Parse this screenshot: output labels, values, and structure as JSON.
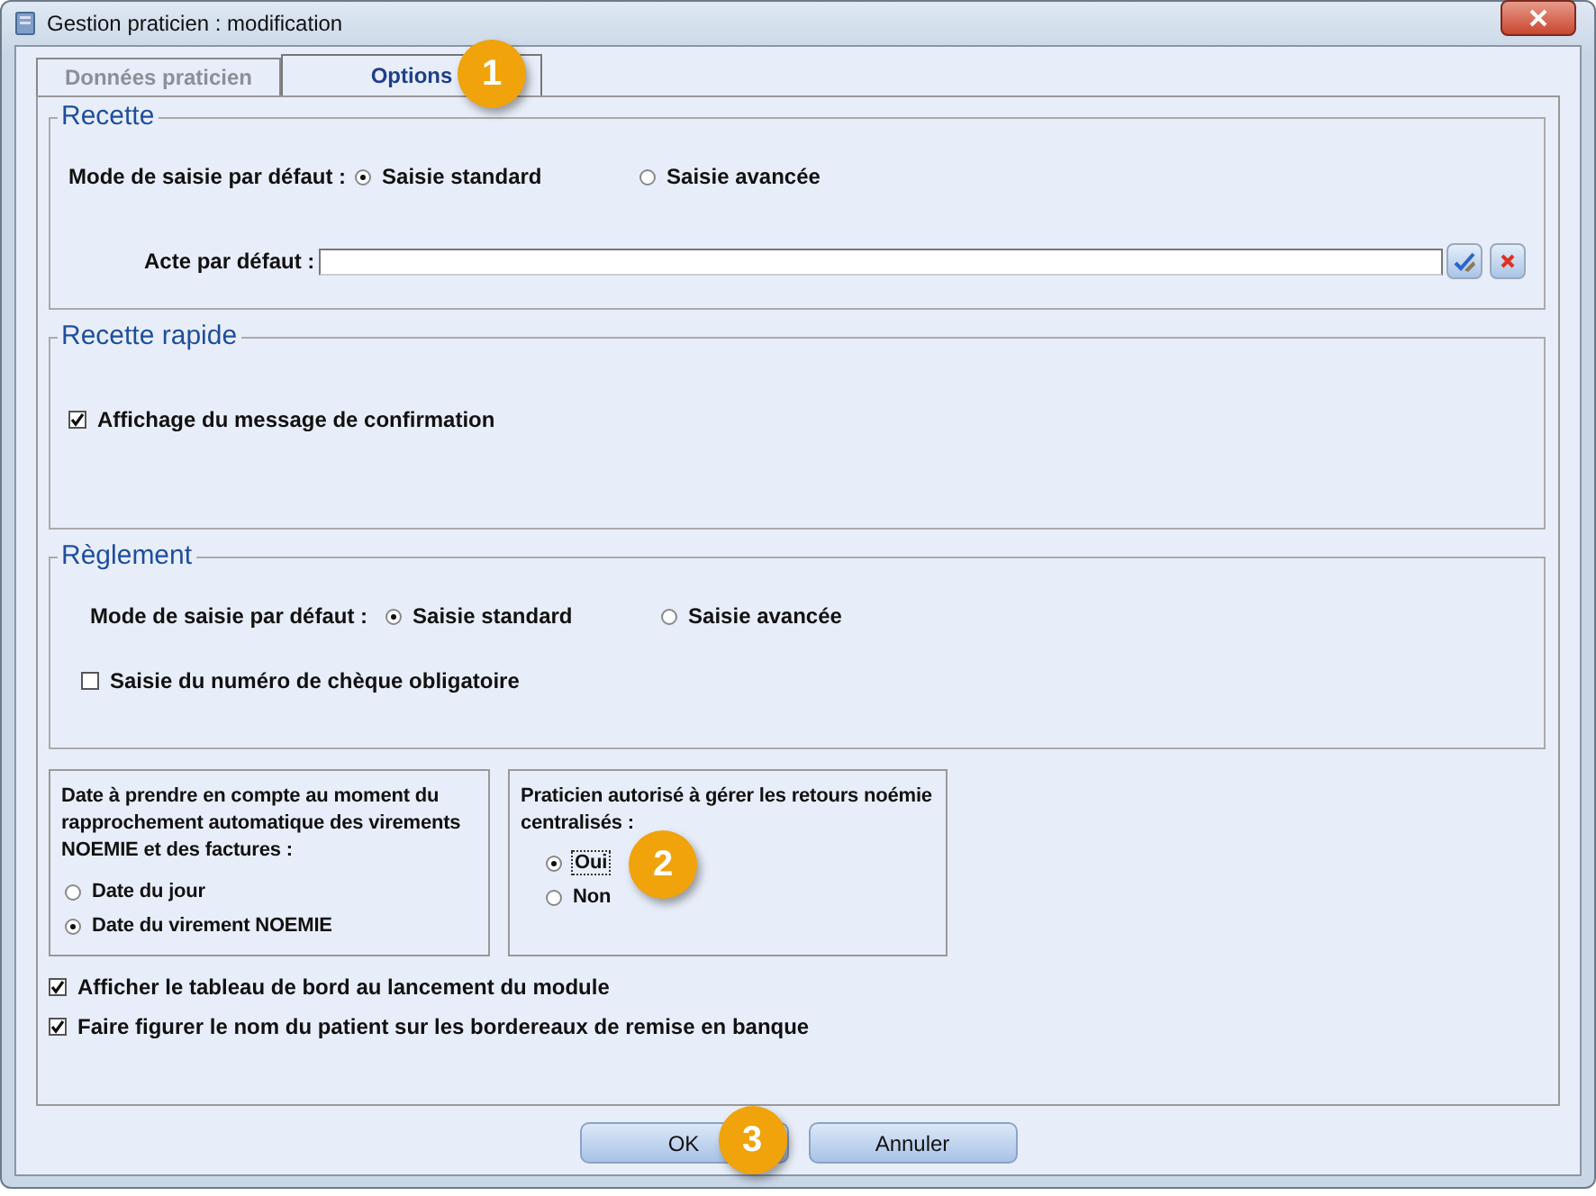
{
  "window": {
    "title": "Gestion praticien : modification"
  },
  "tabs": [
    {
      "label": "Données praticien",
      "selected": false
    },
    {
      "label": "Options",
      "selected": true,
      "callout": "1"
    }
  ],
  "recette": {
    "title": "Recette",
    "mode_label": "Mode de saisie par défaut :",
    "options": [
      {
        "label": "Saisie standard",
        "selected": true
      },
      {
        "label": "Saisie avancée",
        "selected": false
      }
    ],
    "acte_label": "Acte par défaut :"
  },
  "recette_rapide": {
    "title": "Recette rapide",
    "checkbox": {
      "label": "Affichage du message de confirmation",
      "checked": true
    }
  },
  "reglement": {
    "title": "Règlement",
    "mode_label": "Mode de saisie par défaut :",
    "options": [
      {
        "label": "Saisie standard",
        "selected": true
      },
      {
        "label": "Saisie avancée",
        "selected": false
      }
    ],
    "checkbox": {
      "label": "Saisie du numéro de chèque obligatoire",
      "checked": false
    }
  },
  "date_box": {
    "label": "Date à prendre en compte au moment du rapprochement automatique des virements NOEMIE et des factures :",
    "options": [
      {
        "label": "Date du jour",
        "selected": false
      },
      {
        "label": "Date du virement NOEMIE",
        "selected": true
      }
    ]
  },
  "praticien_box": {
    "label": "Praticien autorisé à gérer les retours noémie centralisés :",
    "options": [
      {
        "label": "Oui",
        "selected": true,
        "focused": true,
        "callout": "2"
      },
      {
        "label": "Non",
        "selected": false
      }
    ]
  },
  "checkboxes": [
    {
      "label": "Afficher le tableau de bord au lancement du module",
      "checked": true
    },
    {
      "label": "Faire figurer le nom du patient sur les bordereaux de remise en banque",
      "checked": true
    }
  ],
  "buttons": [
    {
      "label": "OK",
      "callout": "3"
    },
    {
      "label": "Annuler"
    }
  ]
}
